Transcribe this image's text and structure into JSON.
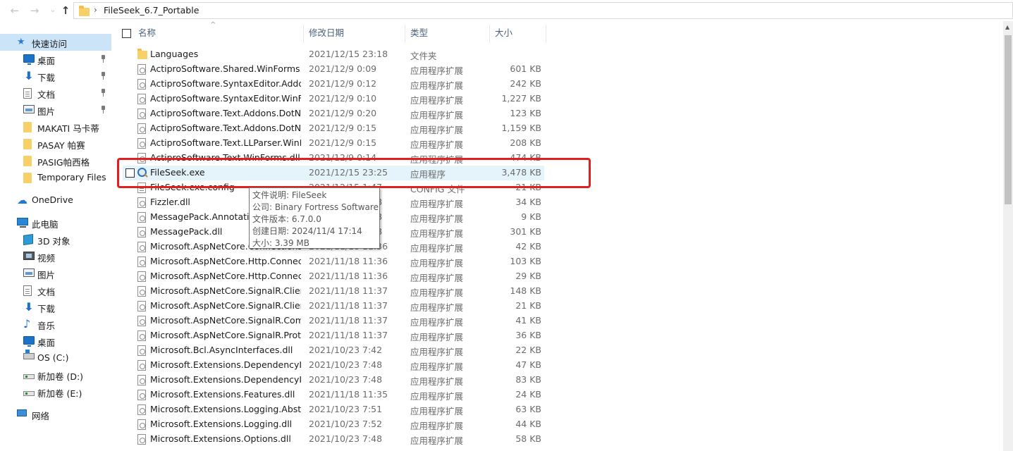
{
  "address": {
    "path": "FileSeek_6.7_Portable"
  },
  "sidebar": {
    "items": [
      {
        "label": "快速访问",
        "icon": "star-icon",
        "selected": true
      },
      {
        "label": "桌面",
        "icon": "desktop-icon",
        "pinned": true
      },
      {
        "label": "下载",
        "icon": "download-icon",
        "pinned": true
      },
      {
        "label": "文档",
        "icon": "document-icon",
        "pinned": true
      },
      {
        "label": "图片",
        "icon": "pictures-icon",
        "pinned": true
      },
      {
        "label": "MAKATI 马卡蒂",
        "icon": "folder-icon"
      },
      {
        "label": "PASAY 帕赛",
        "icon": "folder-icon"
      },
      {
        "label": "PASIG帕西格",
        "icon": "folder-icon"
      },
      {
        "label": "Temporary Files",
        "icon": "folder-icon"
      },
      {
        "label": "OneDrive",
        "icon": "cloud-icon"
      },
      {
        "label": "此电脑",
        "icon": "computer-icon"
      },
      {
        "label": "3D 对象",
        "icon": "3d-objects-icon"
      },
      {
        "label": "视频",
        "icon": "videos-icon"
      },
      {
        "label": "图片",
        "icon": "pictures-icon"
      },
      {
        "label": "文档",
        "icon": "document-icon"
      },
      {
        "label": "下载",
        "icon": "download-icon"
      },
      {
        "label": "音乐",
        "icon": "music-icon"
      },
      {
        "label": "桌面",
        "icon": "desktop-icon"
      },
      {
        "label": "OS (C:)",
        "icon": "os-drive-icon"
      },
      {
        "label": "新加卷 (D:)",
        "icon": "drive-icon"
      },
      {
        "label": "新加卷 (E:)",
        "icon": "drive-icon"
      },
      {
        "label": "网络",
        "icon": "network-icon"
      }
    ]
  },
  "columns": {
    "name": "名称",
    "date": "修改日期",
    "type": "类型",
    "size": "大小"
  },
  "files": [
    {
      "name": "Languages",
      "date": "2021/12/15 23:18",
      "type": "文件夹",
      "size": "",
      "icon": "folder-icon"
    },
    {
      "name": "ActiproSoftware.Shared.WinForms.dll",
      "date": "2021/12/9 0:09",
      "type": "应用程序扩展",
      "size": "601 KB",
      "icon": "dll-icon"
    },
    {
      "name": "ActiproSoftware.SyntaxEditor.Addons.dll",
      "date": "2021/12/9 0:12",
      "type": "应用程序扩展",
      "size": "242 KB",
      "icon": "dll-icon"
    },
    {
      "name": "ActiproSoftware.SyntaxEditor.WinForms.dll",
      "date": "2021/12/9 0:10",
      "type": "应用程序扩展",
      "size": "1,227 KB",
      "icon": "dll-icon"
    },
    {
      "name": "ActiproSoftware.Text.Addons.DotNet.dll",
      "date": "2021/12/9 0:20",
      "type": "应用程序扩展",
      "size": "123 KB",
      "icon": "dll-icon"
    },
    {
      "name": "ActiproSoftware.Text.Addons.DotNet.Wpf.dll",
      "date": "2021/12/9 0:15",
      "type": "应用程序扩展",
      "size": "1,159 KB",
      "icon": "dll-icon"
    },
    {
      "name": "ActiproSoftware.Text.LLParser.WinForms.dll",
      "date": "2021/12/9 0:15",
      "type": "应用程序扩展",
      "size": "208 KB",
      "icon": "dll-icon"
    },
    {
      "name": "ActiproSoftware.Text.WinForms.dll",
      "date": "2021/12/9 0:14",
      "type": "应用程序扩展",
      "size": "474 KB",
      "icon": "dll-icon"
    },
    {
      "name": "FileSeek.exe",
      "date": "2021/12/15 23:25",
      "type": "应用程序",
      "size": "3,478 KB",
      "icon": "exe-icon",
      "highlight": true
    },
    {
      "name": "FileSeek.exe.config",
      "date": "2021/12/15 1:47",
      "type": "CONFIG 文件",
      "size": "21 KB",
      "icon": "config-icon"
    },
    {
      "name": "Fizzler.dll",
      "date": "2021/10/23 7:48",
      "type": "应用程序扩展",
      "size": "34 KB",
      "icon": "dll-icon"
    },
    {
      "name": "MessagePack.Annotations.dll",
      "date": "2021/10/23 7:48",
      "type": "应用程序扩展",
      "size": "9 KB",
      "icon": "dll-icon"
    },
    {
      "name": "MessagePack.dll",
      "date": "2021/10/23 7:48",
      "type": "应用程序扩展",
      "size": "301 KB",
      "icon": "dll-icon"
    },
    {
      "name": "Microsoft.AspNetCore.Connections.Abstractions.dll",
      "date": "2021/11/18 11:36",
      "type": "应用程序扩展",
      "size": "42 KB",
      "icon": "dll-icon"
    },
    {
      "name": "Microsoft.AspNetCore.Http.Connections.Client.dll",
      "date": "2021/11/18 11:36",
      "type": "应用程序扩展",
      "size": "103 KB",
      "icon": "dll-icon"
    },
    {
      "name": "Microsoft.AspNetCore.Http.Connections.Common.dll",
      "date": "2021/11/18 11:36",
      "type": "应用程序扩展",
      "size": "29 KB",
      "icon": "dll-icon"
    },
    {
      "name": "Microsoft.AspNetCore.SignalR.Client.Core.dll",
      "date": "2021/11/18 11:37",
      "type": "应用程序扩展",
      "size": "148 KB",
      "icon": "dll-icon"
    },
    {
      "name": "Microsoft.AspNetCore.SignalR.Client.dll",
      "date": "2021/11/18 11:37",
      "type": "应用程序扩展",
      "size": "21 KB",
      "icon": "dll-icon"
    },
    {
      "name": "Microsoft.AspNetCore.SignalR.Common.dll",
      "date": "2021/11/18 11:37",
      "type": "应用程序扩展",
      "size": "41 KB",
      "icon": "dll-icon"
    },
    {
      "name": "Microsoft.AspNetCore.SignalR.Protocols.Json.dll",
      "date": "2021/11/18 11:37",
      "type": "应用程序扩展",
      "size": "36 KB",
      "icon": "dll-icon"
    },
    {
      "name": "Microsoft.Bcl.AsyncInterfaces.dll",
      "date": "2021/10/23 7:42",
      "type": "应用程序扩展",
      "size": "22 KB",
      "icon": "dll-icon"
    },
    {
      "name": "Microsoft.Extensions.DependencyInjection.Abstractions.dll",
      "date": "2021/10/23 7:48",
      "type": "应用程序扩展",
      "size": "47 KB",
      "icon": "dll-icon"
    },
    {
      "name": "Microsoft.Extensions.DependencyInjection.dll",
      "date": "2021/10/23 7:48",
      "type": "应用程序扩展",
      "size": "83 KB",
      "icon": "dll-icon"
    },
    {
      "name": "Microsoft.Extensions.Features.dll",
      "date": "2021/11/18 11:35",
      "type": "应用程序扩展",
      "size": "24 KB",
      "icon": "dll-icon"
    },
    {
      "name": "Microsoft.Extensions.Logging.Abstractions.dll",
      "date": "2021/10/23 7:51",
      "type": "应用程序扩展",
      "size": "63 KB",
      "icon": "dll-icon"
    },
    {
      "name": "Microsoft.Extensions.Logging.dll",
      "date": "2021/10/23 7:52",
      "type": "应用程序扩展",
      "size": "44 KB",
      "icon": "dll-icon"
    },
    {
      "name": "Microsoft.Extensions.Options.dll",
      "date": "2021/10/23 7:48",
      "type": "应用程序扩展",
      "size": "58 KB",
      "icon": "dll-icon"
    }
  ],
  "tooltip": {
    "lines": [
      "文件说明: FileSeek",
      "公司: Binary Fortress Software",
      "文件版本: 6.7.0.0",
      "创建日期: 2024/11/4 17:14",
      "大小: 3.39 MB"
    ]
  },
  "colors": {
    "selection": "#cce4f7",
    "hover_row": "#e5f3fb",
    "annotation": "#e02020",
    "folder": "#f7d167"
  }
}
